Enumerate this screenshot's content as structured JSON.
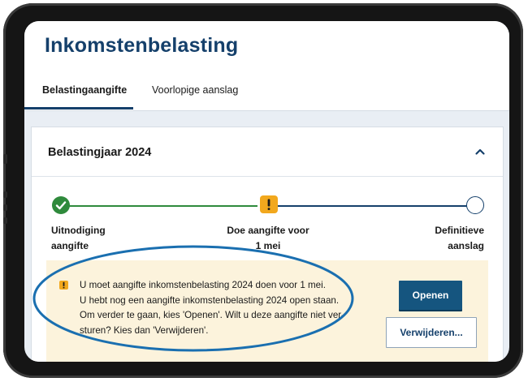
{
  "header": {
    "title": "Inkomstenbelasting",
    "tabs": [
      {
        "label": "Belastingaangifte",
        "active": true
      },
      {
        "label": "Voorlopige aanslag",
        "active": false
      }
    ]
  },
  "card": {
    "title": "Belastingjaar 2024",
    "chevron_icon": "chevron-up-icon"
  },
  "stepper": {
    "steps": [
      {
        "line1": "Uitnodiging",
        "line2": "aangifte",
        "status": "done"
      },
      {
        "line1": "Doe aangifte voor",
        "line2": "1 mei",
        "status": "warning"
      },
      {
        "line1": "Definitieve",
        "line2": "aanslag",
        "status": "open"
      }
    ]
  },
  "alert": {
    "lines": [
      "U moet aangifte inkomstenbelasting 2024 doen voor 1 mei.",
      "U hebt nog een aangifte inkomstenbelasting 2024 open staan.",
      "Om verder te gaan, kies 'Openen'. Wilt u deze aangifte niet ver-",
      "sturen? Kies dan 'Verwijderen'."
    ],
    "open_button": "Openen",
    "delete_button": "Verwijderen..."
  },
  "colors": {
    "brand": "#15406b",
    "success": "#2f8a3c",
    "warning": "#f2a81d",
    "alert_bg": "#fcf3dc",
    "highlight": "#1a6fb0"
  }
}
